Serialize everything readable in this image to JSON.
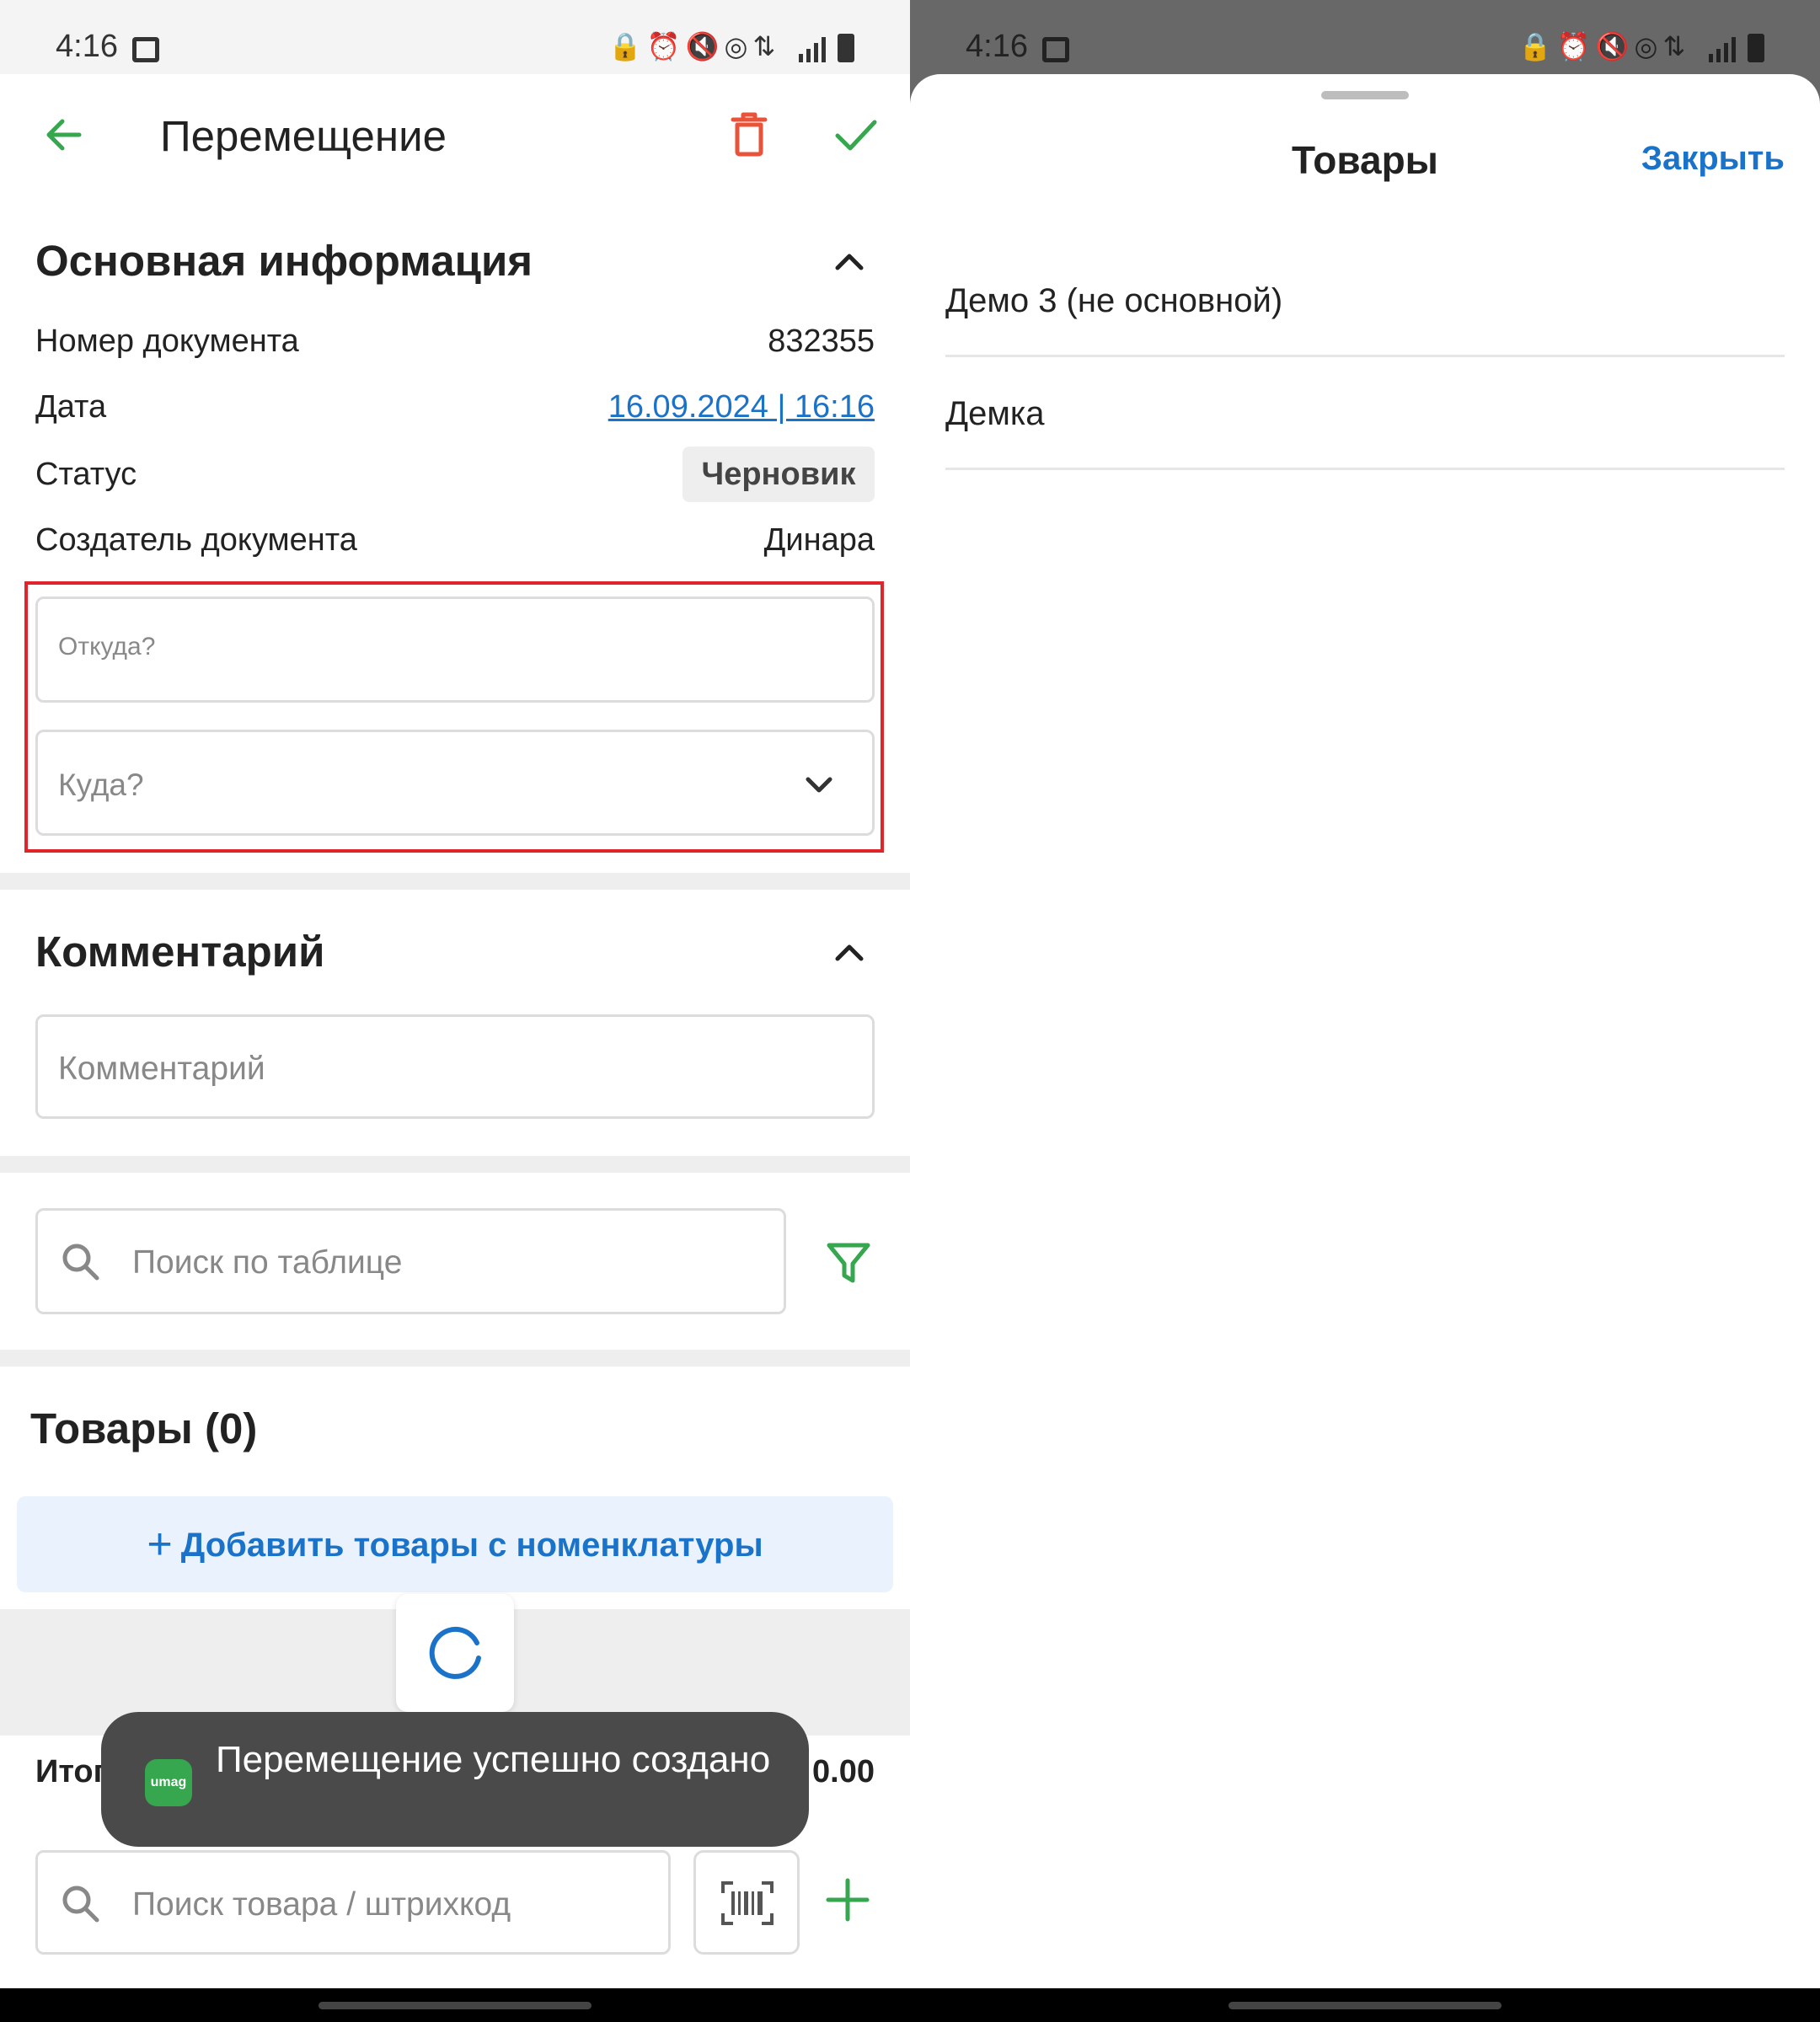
{
  "status_bar": {
    "time": "4:16"
  },
  "left": {
    "header": {
      "title": "Перемещение"
    },
    "main_info": {
      "title": "Основная информация",
      "rows": [
        {
          "label": "Номер документа",
          "value": "832355"
        },
        {
          "label": "Дата",
          "value": "16.09.2024 | 16:16"
        },
        {
          "label": "Статус",
          "value": "Черновик"
        },
        {
          "label": "Создатель документа",
          "value": "Динара"
        }
      ],
      "from_field": {
        "label": "Откуда?"
      },
      "to_field": {
        "placeholder": "Куда?"
      }
    },
    "comment": {
      "title": "Комментарий",
      "placeholder": "Комментарий"
    },
    "table_search": {
      "placeholder": "Поиск по таблице"
    },
    "products": {
      "title": "Товары (0)",
      "add_button": "Добавить товары с номенклатуры"
    },
    "totals": {
      "label": "Итого",
      "value": "0.00"
    },
    "toast": {
      "logo_text": "umag",
      "message": "Перемещение успешно создано"
    },
    "product_search": {
      "placeholder": "Поиск товара / штрихкод"
    }
  },
  "right": {
    "sheet": {
      "title": "Товары",
      "close_label": "Закрыть",
      "items": [
        "Демо 3 (не основной)",
        "Демка"
      ]
    }
  },
  "colors": {
    "accent_green": "#36a64f",
    "link_blue": "#1a73c8",
    "danger_red": "#e8533a",
    "highlight_red": "#e0242a"
  }
}
